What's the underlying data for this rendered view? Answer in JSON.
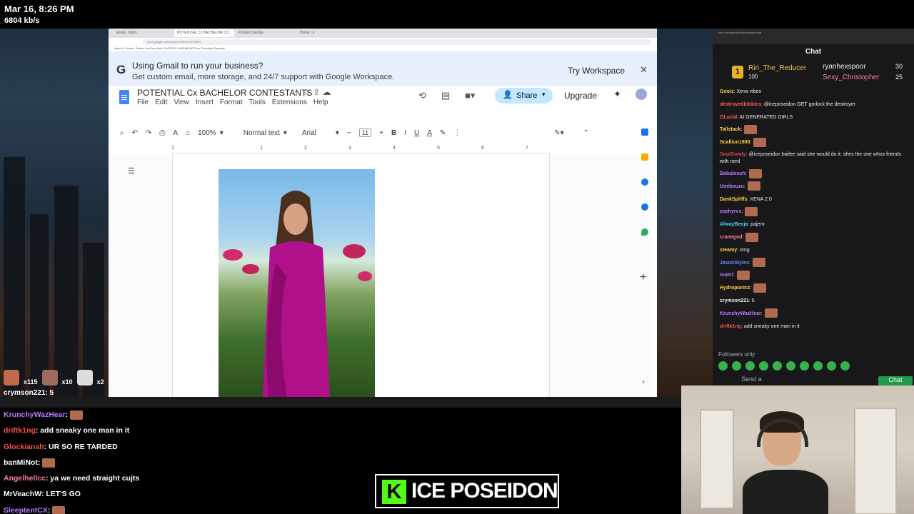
{
  "stream": {
    "timestamp": "Mar 16, 8:26 PM",
    "bitrate": "6804 kb/s"
  },
  "browser": {
    "tabs": [
      "Gmail - Inbox",
      "POTENTIAL Cx BACHELOR CO",
      "Kickbot Overlay",
      "Home / X"
    ],
    "url": "docs.google.com/document/d/1Y-UHC5NT",
    "bookmarks": "Apps   X / Home / Twitter   YouTube   Kick   CHATBOX   DASHBOARD   Ice Poseidon   Deposits"
  },
  "banner": {
    "logo": "G",
    "title": "Using Gmail to run your business?",
    "subtitle": "Get custom email, more storage, and 24/7 support with Google Workspace.",
    "try_label": "Try Workspace",
    "close": "✕"
  },
  "doc": {
    "title": "POTENTIAL Cx BACHELOR CONTESTANTS",
    "menu": [
      "File",
      "Edit",
      "View",
      "Insert",
      "Format",
      "Tools",
      "Extensions",
      "Help"
    ],
    "share_label": "Share",
    "upgrade_label": "Upgrade",
    "toolbar": {
      "zoom": "100%",
      "style": "Normal text",
      "font": "Arial",
      "font_size": "11"
    },
    "ruler_marks": [
      "1",
      "1",
      "2",
      "3",
      "4",
      "5",
      "6",
      "7"
    ]
  },
  "chat": {
    "title": "Chat",
    "topbar": "kick.com/popout/iceposeidon/chat",
    "leaderboard": {
      "first": {
        "rank": "1",
        "name": "Riri_The_Reducer",
        "score": "100"
      },
      "second": {
        "name": "ryanhexspoor",
        "score": "30"
      },
      "third": {
        "name": "Sexy_Christopher",
        "score": "25"
      }
    },
    "messages": [
      {
        "user": "Gooiz",
        "text": ": Xena vibes",
        "color": "#ffd23d"
      },
      {
        "user": "destroyedlobbies",
        "text": ": @iceposeidon GET gorlock the destroyer",
        "color": "#ff5a5a"
      },
      {
        "user": "OLucid",
        "text": ": AI GENERATED GIRLS",
        "color": "#ff5a5a"
      },
      {
        "user": "Tallstack",
        "text": ":",
        "color": "#ffd23d"
      },
      {
        "user": "Scallion1600",
        "text": ":",
        "color": "#ffd23d"
      },
      {
        "user": "SoulSoody",
        "text": ": @iceposeidon bailee said she would do it. shes the one whos friends with nerd",
        "color": "#d14a4a"
      },
      {
        "user": "Babaloosh",
        "text": ":",
        "color": "#b97cff"
      },
      {
        "user": "Umibouzu",
        "text": ":",
        "color": "#b97cff"
      },
      {
        "user": "DankSpliffs",
        "text": ": XENA 2.0",
        "color": "#ffd23d"
      },
      {
        "user": "zephyrvx",
        "text": ":",
        "color": "#b97cff"
      },
      {
        "user": "AlwayBenja",
        "text": ": pajero",
        "color": "#4ad2ff"
      },
      {
        "user": "cranegod",
        "text": ":",
        "color": "#ff7ba8"
      },
      {
        "user": "steamy",
        "text": ": omg",
        "color": "#ffd23d"
      },
      {
        "user": "JasonStyles",
        "text": ":",
        "color": "#6b8cff"
      },
      {
        "user": "ma0ri",
        "text": ":",
        "color": "#b97cff"
      },
      {
        "user": "Hydroponicz",
        "text": ":",
        "color": "#ffd23d"
      },
      {
        "user": "crymson221",
        "text": ": 5",
        "color": "#efeff1"
      },
      {
        "user": "KrunchyWazHear",
        "text": ":",
        "color": "#b97cff"
      },
      {
        "user": "driftk1ng",
        "text": ": add sneaky one man in it",
        "color": "#ff4d4d"
      }
    ],
    "followers_only": "Followers only",
    "send_placeholder": "Send a",
    "chat_button": "Chat"
  },
  "overlay_chat": {
    "emote_counts": [
      "x115",
      "x10",
      "x2"
    ],
    "first_line": "crymson221: 5",
    "messages": [
      {
        "user": "KrunchyWazHear",
        "text": ":",
        "color": "#b97cff"
      },
      {
        "user": "driftk1ng",
        "text": ": add sneaky one man in it",
        "color": "#ff4d4d"
      },
      {
        "user": "Glockianah",
        "text": ": UR SO RE TARDED",
        "color": "#ff4d4d"
      },
      {
        "user": "banMiNot",
        "text": ":",
        "color": "#ffffff"
      },
      {
        "user": "Angelhellcc",
        "text": ": ya we need straight cujts",
        "color": "#ff7ba8"
      },
      {
        "user": "MrVeachW",
        "text": ": LET'S GO",
        "color": "#ffffff"
      },
      {
        "user": "SleeptentCX",
        "text": ":",
        "color": "#b97cff"
      }
    ]
  },
  "brand": {
    "logo_letter": "K",
    "name": "ICE POSEIDON",
    "accent": "#53fc18"
  }
}
